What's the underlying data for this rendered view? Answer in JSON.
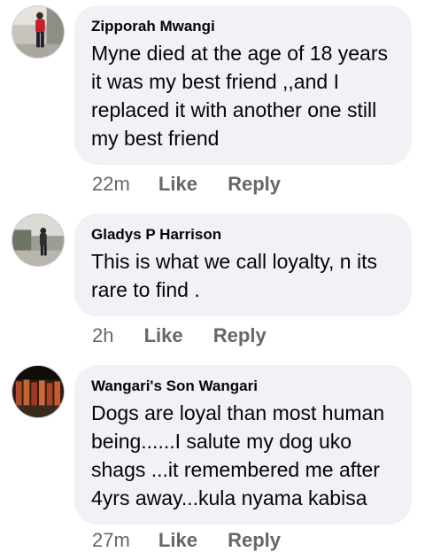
{
  "comments": [
    {
      "author": "Zipporah Mwangi",
      "text": "Myne died at the age of 18 years it was my best friend ,,and I replaced it with another one still my best friend",
      "time": "22m",
      "like_label": "Like",
      "reply_label": "Reply"
    },
    {
      "author": "Gladys P Harrison",
      "text": "This is what we call loyalty, n its rare to find .",
      "time": "2h",
      "like_label": "Like",
      "reply_label": "Reply"
    },
    {
      "author": "Wangari's Son Wangari",
      "text": "Dogs are loyal than most human being......I salute my dog uko shags ...it remembered me after 4yrs away...kula nyama kabisa",
      "time": "27m",
      "like_label": "Like",
      "reply_label": "Reply"
    }
  ],
  "colors": {
    "bubble_bg": "#f0f2f5",
    "meta_text": "#65676b",
    "body_text": "#050505"
  }
}
